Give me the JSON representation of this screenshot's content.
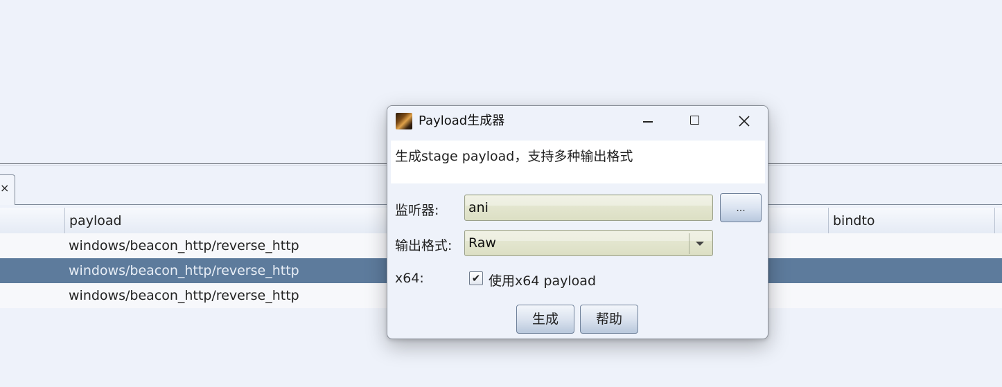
{
  "background": {
    "tab_close_glyph": "×",
    "table": {
      "columns": [
        "payload",
        "bindto"
      ],
      "rows": [
        {
          "payload": "windows/beacon_http/reverse_http",
          "selected": false
        },
        {
          "payload": "windows/beacon_http/reverse_http",
          "selected": true
        },
        {
          "payload": "windows/beacon_http/reverse_http",
          "selected": false
        }
      ]
    }
  },
  "dialog": {
    "title": "Payload生成器",
    "description": "生成stage payload，支持多种输出格式",
    "listener_label": "监听器:",
    "listener_value": "ani",
    "browse_label": "...",
    "format_label": "输出格式:",
    "format_value": "Raw",
    "x64_label": "x64:",
    "x64_checkbox_label": "使用x64 payload",
    "x64_checked": true,
    "generate_button": "生成",
    "help_button": "帮助"
  },
  "colors": {
    "selected_row": "#5d7b9c",
    "field_bg": "#dcdfc4"
  }
}
